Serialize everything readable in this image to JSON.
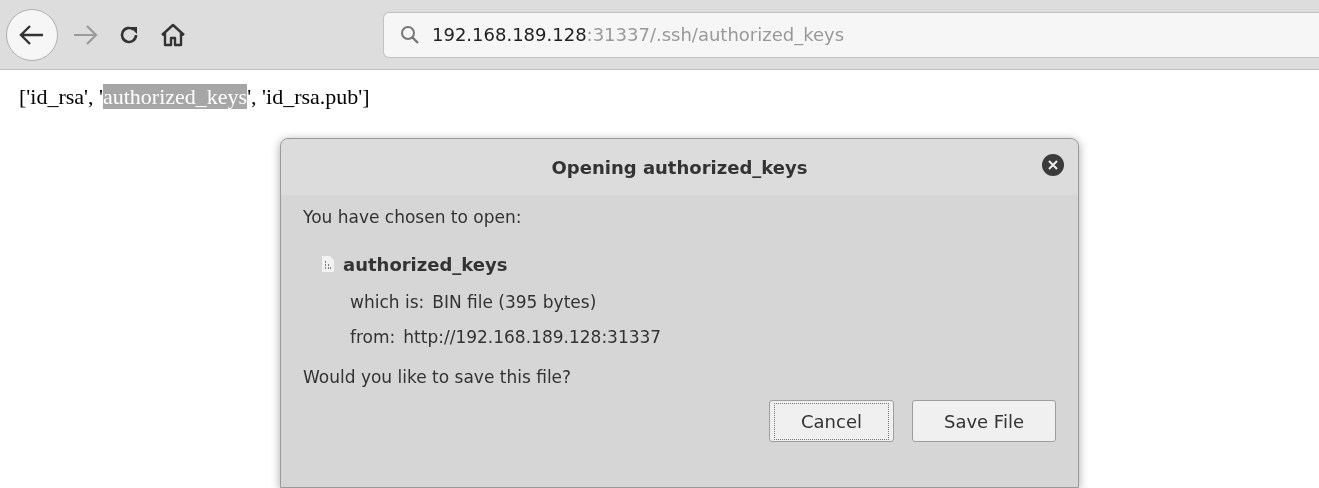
{
  "toolbar": {
    "back": {
      "disabled": false
    },
    "forward": {
      "disabled": true
    },
    "url": {
      "host": "192.168.189.128",
      "rest": ":31337/.ssh/authorized_keys"
    }
  },
  "page_text": [
    {
      "text": "['id_rsa', '",
      "selected": false
    },
    {
      "text": "authorized_keys",
      "selected": true
    },
    {
      "text": "', 'id_rsa.pub']",
      "selected": false
    }
  ],
  "dialog": {
    "title": "Opening authorized_keys",
    "intro": "You have chosen to open:",
    "file_name": "authorized_keys",
    "details": [
      {
        "label": "which is:",
        "value": "BIN file (395 bytes)"
      },
      {
        "label": "from:",
        "value": "http://192.168.189.128:31337"
      }
    ],
    "question": "Would you like to save this file?",
    "buttons": [
      {
        "label": "Cancel",
        "focused": true
      },
      {
        "label": "Save File",
        "focused": false
      }
    ]
  }
}
